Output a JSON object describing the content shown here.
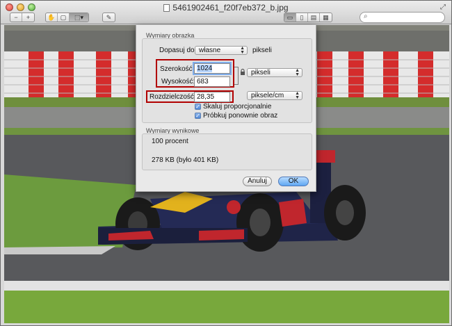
{
  "window": {
    "title": "5461902461_f20f7eb372_b.jpg"
  },
  "toolbar": {
    "left_icons": [
      "zoom-out-icon",
      "zoom-in-icon",
      "hand-icon",
      "crop-icon",
      "selection-icon",
      "pen-icon"
    ],
    "right_icons": [
      "view-single-icon",
      "view-sidebar-icon",
      "view-contact-icon",
      "view-grid-icon"
    ],
    "search_placeholder": ""
  },
  "dialog": {
    "section1_title": "Wymiary obrazka",
    "fit_label": "Dopasuj do:",
    "fit_value": "własne",
    "fit_unit": "pikseli",
    "width_label": "Szerokość:",
    "width_value": "1024",
    "height_label": "Wysokość:",
    "height_value": "683",
    "size_unit": "pikseli",
    "resolution_label": "Rozdzielczość:",
    "resolution_value": "28,35",
    "resolution_unit": "piksele/cm",
    "scale_label": "Skaluj proporcjonalnie",
    "scale_checked": true,
    "resample_label": "Próbkuj ponownie obraz",
    "resample_checked": true,
    "section2_title": "Wymiary wynikowe",
    "result_percent": "100 procent",
    "result_size": "278 KB (było 401 KB)",
    "cancel_label": "Anuluj",
    "ok_label": "OK"
  },
  "colors": {
    "highlight_box": "#b10000",
    "default_button": "#5ea6f2"
  }
}
